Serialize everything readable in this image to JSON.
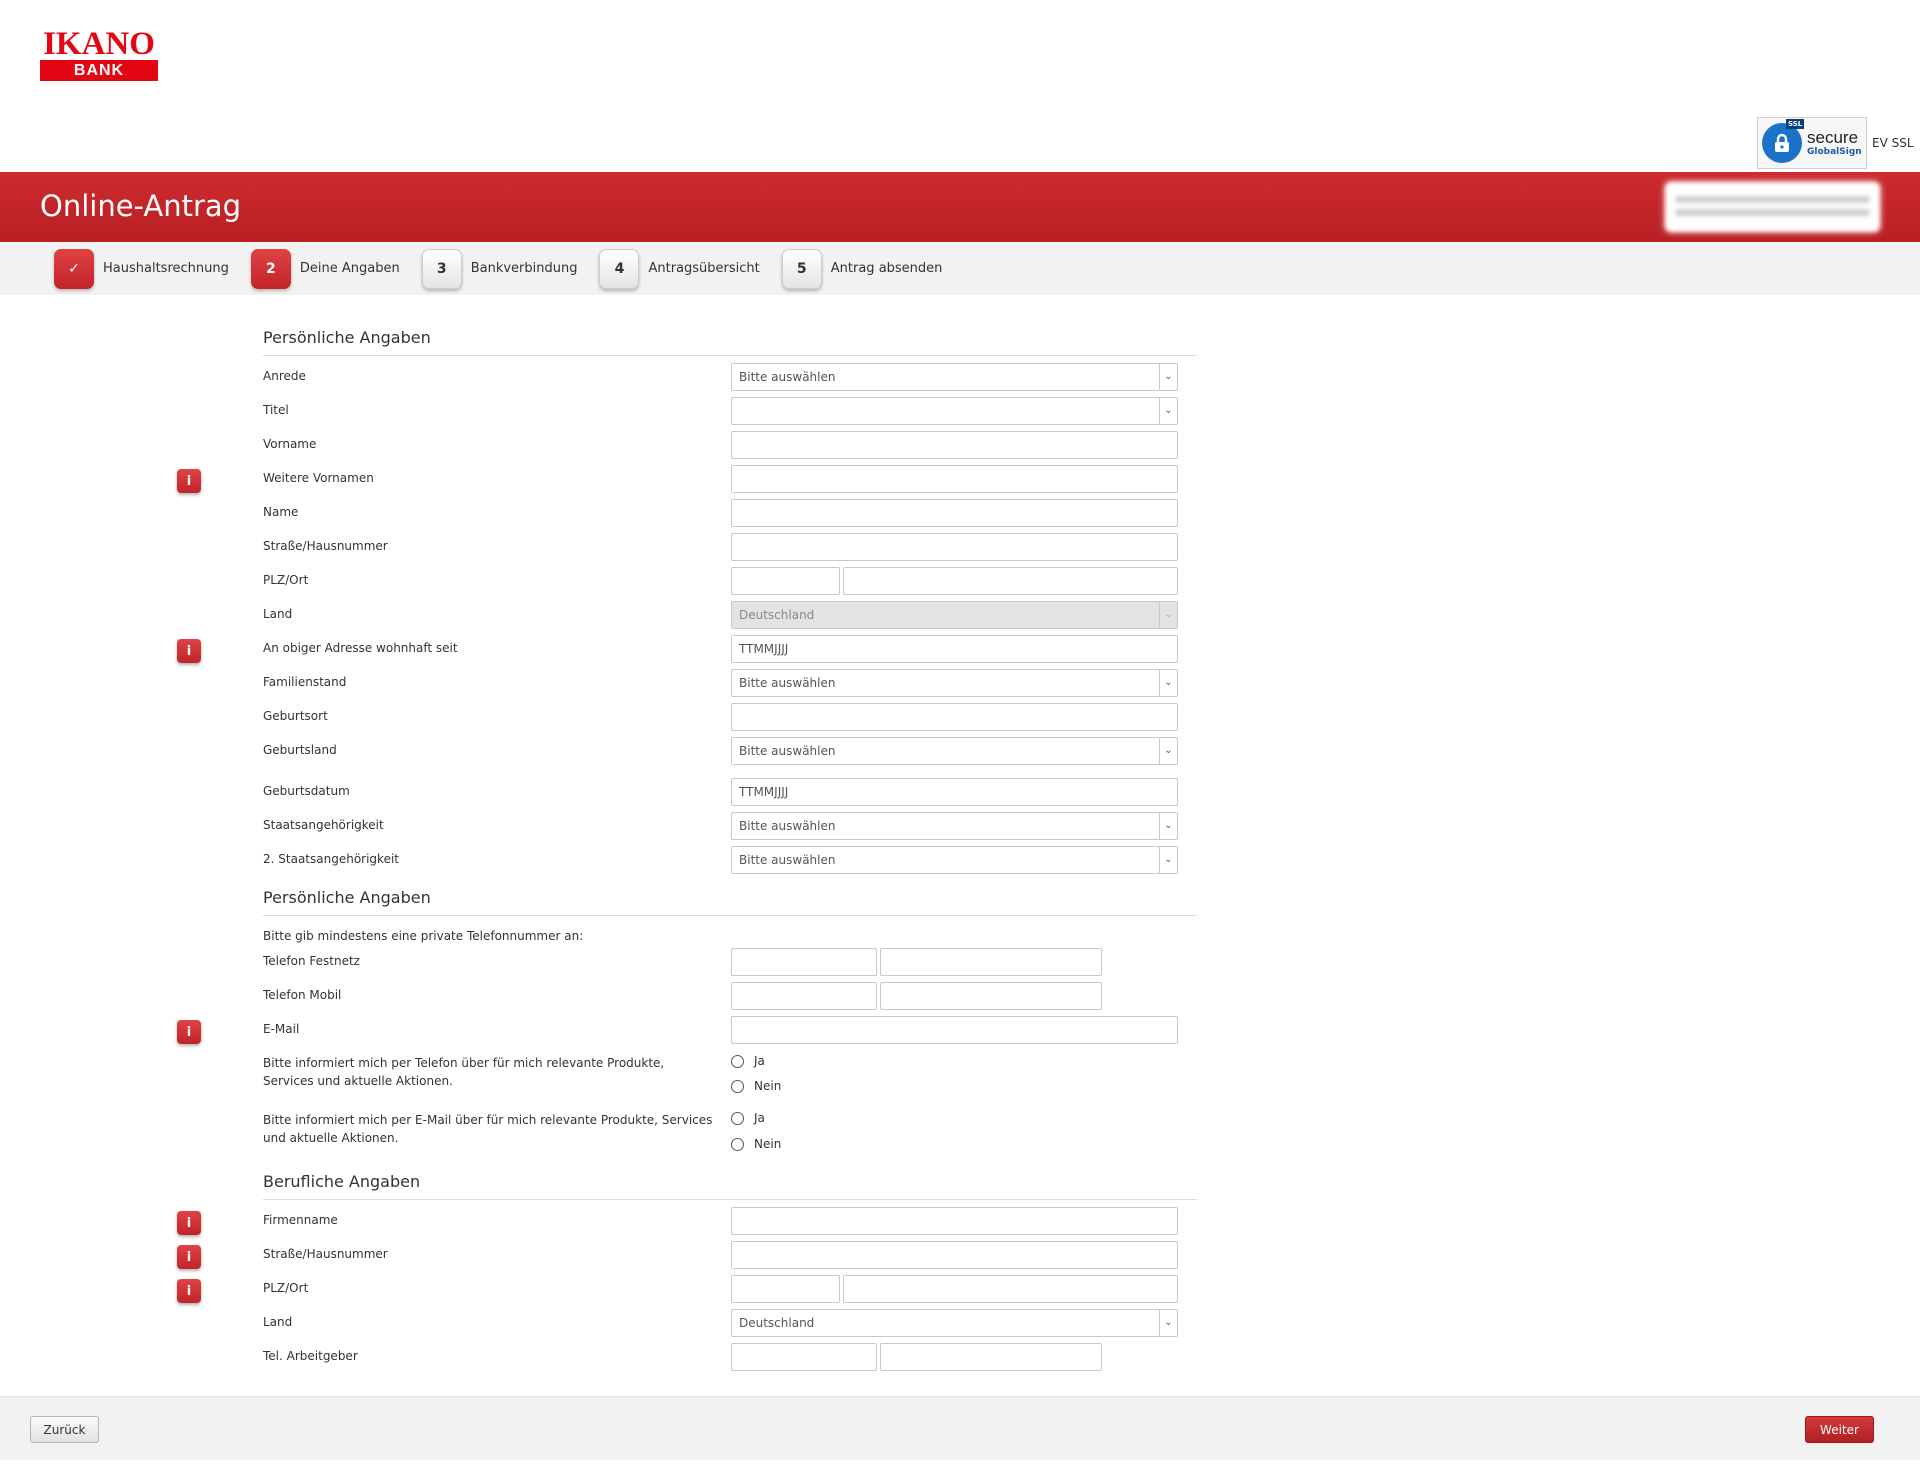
{
  "header": {
    "logo_top": "IKANO",
    "logo_bottom": "BANK",
    "ssl_secure": "secure",
    "ssl_globalsign": "GlobalSign",
    "ssl_tag": "SSL",
    "ssl_ev": "EV SSL",
    "title": "Online-Antrag"
  },
  "steps": [
    {
      "num": "✓",
      "label": "Haushaltsrechnung"
    },
    {
      "num": "2",
      "label": "Deine Angaben"
    },
    {
      "num": "3",
      "label": "Bankverbindung"
    },
    {
      "num": "4",
      "label": "Antragsübersicht"
    },
    {
      "num": "5",
      "label": "Antrag absenden"
    }
  ],
  "personal": {
    "title": "Persönliche Angaben",
    "anrede": {
      "label": "Anrede",
      "value": "Bitte auswählen"
    },
    "titel": {
      "label": "Titel",
      "value": ""
    },
    "vorname": {
      "label": "Vorname"
    },
    "weitere_vornamen": {
      "label": "Weitere Vornamen"
    },
    "name": {
      "label": "Name"
    },
    "strasse": {
      "label": "Straße/Hausnummer"
    },
    "plz_ort": {
      "label": "PLZ/Ort"
    },
    "land": {
      "label": "Land",
      "value": "Deutschland"
    },
    "wohnhaft_seit": {
      "label": "An obiger Adresse wohnhaft seit",
      "placeholder": "TTMMJJJJ"
    },
    "familienstand": {
      "label": "Familienstand",
      "value": "Bitte auswählen"
    },
    "geburtsort": {
      "label": "Geburtsort"
    },
    "geburtsland": {
      "label": "Geburtsland",
      "value": "Bitte auswählen"
    },
    "geburtsdatum": {
      "label": "Geburtsdatum",
      "placeholder": "TTMMJJJJ"
    },
    "staatsangehoerigkeit": {
      "label": "Staatsangehörigkeit",
      "value": "Bitte auswählen"
    },
    "staatsangehoerigkeit2": {
      "label": "2. Staatsangehörigkeit",
      "value": "Bitte auswählen"
    }
  },
  "contact": {
    "title": "Persönliche Angaben",
    "hint": "Bitte gib mindestens eine private Telefonnummer an:",
    "festnetz": {
      "label": "Telefon Festnetz"
    },
    "mobil": {
      "label": "Telefon Mobil"
    },
    "email": {
      "label": "E-Mail"
    },
    "phone_consent": {
      "label": "Bitte informiert mich per Telefon über für mich relevante Produkte, Services und aktuelle Aktionen.",
      "yes": "Ja",
      "no": "Nein"
    },
    "email_consent": {
      "label": "Bitte informiert mich per E-Mail über für mich relevante Produkte, Services und aktuelle Aktionen.",
      "yes": "Ja",
      "no": "Nein"
    }
  },
  "job": {
    "title": "Berufliche Angaben",
    "firmenname": {
      "label": "Firmenname"
    },
    "strasse": {
      "label": "Straße/Hausnummer"
    },
    "plz_ort": {
      "label": "PLZ/Ort"
    },
    "land": {
      "label": "Land",
      "value": "Deutschland"
    },
    "tel": {
      "label": "Tel. Arbeitgeber"
    }
  },
  "footer": {
    "back": "Zurück",
    "next": "Weiter"
  },
  "icons": {
    "info": "i",
    "chevron": "⌄"
  },
  "colors": {
    "brand_red": "#c12428",
    "logo_red": "#e30613"
  }
}
